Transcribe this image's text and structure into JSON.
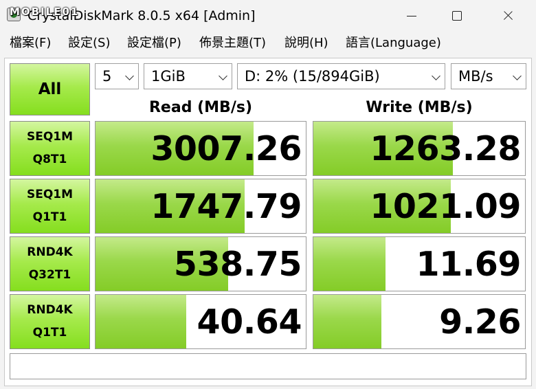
{
  "window": {
    "title": "CrystalDiskMark 8.0.5 x64 [Admin]",
    "watermark": "MOBILE01"
  },
  "menu": [
    {
      "label": "檔案(F)"
    },
    {
      "label": "設定(S)"
    },
    {
      "label": "設定檔(P)"
    },
    {
      "label": "佈景主題(T)"
    },
    {
      "label": "說明(H)"
    },
    {
      "label": "語言(Language)"
    }
  ],
  "controls": {
    "all_label": "All",
    "count": "5",
    "size": "1GiB",
    "drive": "D: 2% (15/894GiB)",
    "unit": "MB/s"
  },
  "headers": {
    "read": "Read (MB/s)",
    "write": "Write (MB/s)"
  },
  "tests": [
    {
      "line1": "SEQ1M",
      "line2": "Q8T1",
      "read": "3007.26",
      "write": "1263.28"
    },
    {
      "line1": "SEQ1M",
      "line2": "Q1T1",
      "read": "1747.79",
      "write": "1021.09"
    },
    {
      "line1": "RND4K",
      "line2": "Q32T1",
      "read": "538.75",
      "write": "11.69"
    },
    {
      "line1": "RND4K",
      "line2": "Q1T1",
      "read": "40.64",
      "write": "9.26"
    }
  ],
  "bar_levels": {
    "read": [
      0.75,
      0.71,
      0.63,
      0.43
    ],
    "write": [
      0.66,
      0.65,
      0.34,
      0.32
    ]
  },
  "colors": {
    "button_green": "#85de1e",
    "bar_green": "#84cc27"
  },
  "icons": {
    "app": "crystaldiskmark-icon",
    "minimize": "minimize-icon",
    "maximize": "maximize-icon",
    "close": "close-icon",
    "dropdown": "chevron-down-icon"
  }
}
